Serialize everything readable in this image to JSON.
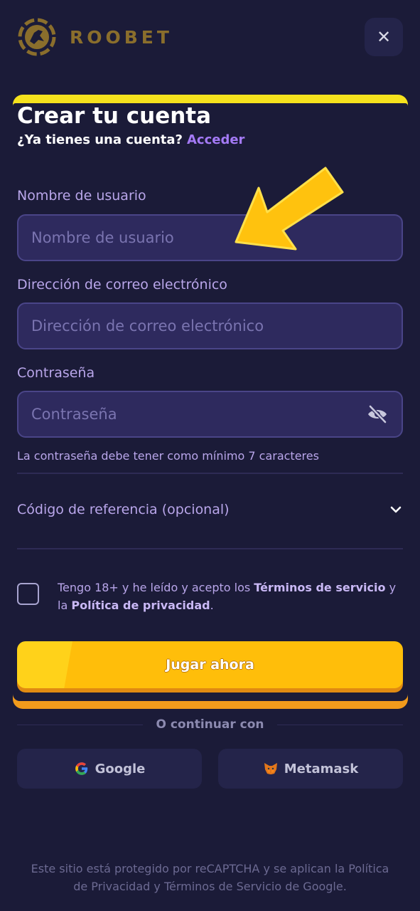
{
  "brand": {
    "name": "ROOBET",
    "logo_icon": "roobet-kangaroo-logo"
  },
  "header": {
    "close_icon": "close-icon"
  },
  "form": {
    "title": "Crear tu cuenta",
    "subtitle": "¿Ya tienes una cuenta?",
    "login_link": "Acceder",
    "username": {
      "label": "Nombre de usuario",
      "placeholder": "Nombre de usuario",
      "value": ""
    },
    "email": {
      "label": "Dirección de correo electrónico",
      "placeholder": "Dirección de correo electrónico",
      "value": ""
    },
    "password": {
      "label": "Contraseña",
      "placeholder": "Contraseña",
      "value": "",
      "toggle_icon": "eye-off-icon"
    },
    "password_hint": "La contraseña debe tener como mínimo 7 caracteres",
    "referral": {
      "label": "Código de referencia (opcional)",
      "icon": "chevron-down-icon"
    },
    "terms": {
      "prefix": "Tengo 18+ y he leído y acepto los",
      "terms_link": "Términos de servicio",
      "middle": "y la",
      "privacy_link": "Política de privacidad",
      "suffix": ".",
      "checked": false
    },
    "submit_label": "Jugar ahora"
  },
  "social": {
    "divider_text": "O continuar con",
    "google_label": "Google",
    "metamask_label": "Metamask"
  },
  "footer": {
    "line1": "Este sitio está protegido por reCAPTCHA y se aplican la Política",
    "line2": "de Privacidad y Términos de Servicio de Google."
  },
  "colors": {
    "background": "#1b1b38",
    "accent_purple": "#a47af6",
    "button_yellow": "#ffbe0a",
    "frame_yellow": "#f6e21d",
    "frame_orange": "#f19a1c",
    "brand_gold": "#8a6e2c"
  }
}
